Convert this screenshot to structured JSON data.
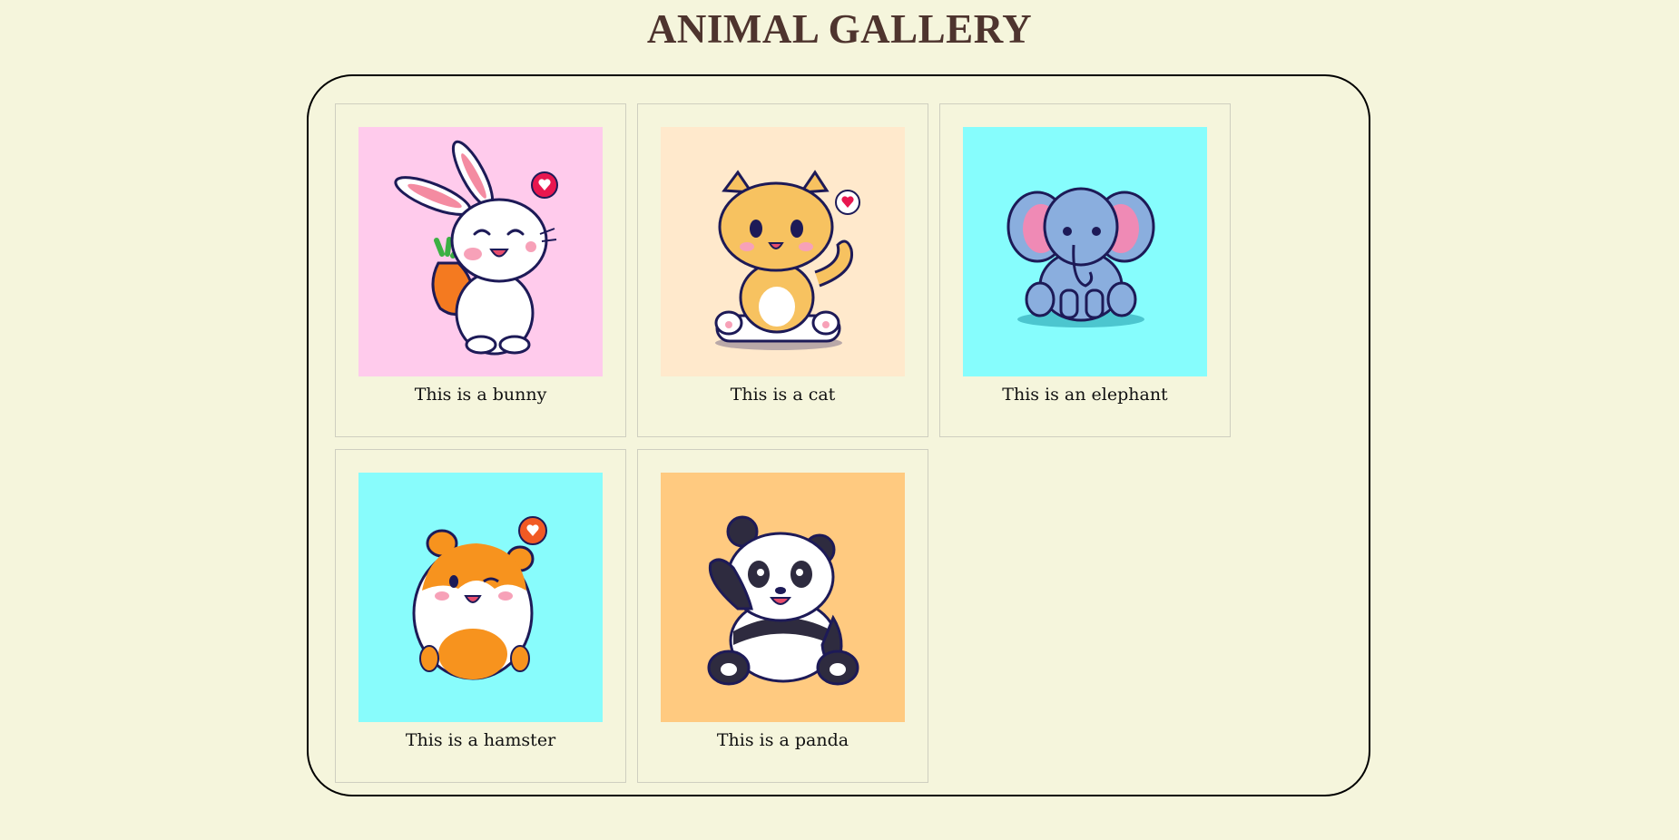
{
  "page": {
    "title": "ANIMAL GALLERY"
  },
  "gallery": {
    "items": [
      {
        "animal": "bunny",
        "caption": "This is a bunny",
        "background": "#ffcbec",
        "icon": "bunny-icon"
      },
      {
        "animal": "cat",
        "caption": "This is a cat",
        "background": "#ffe9cc",
        "icon": "cat-icon"
      },
      {
        "animal": "elephant",
        "caption": "This is an elephant",
        "background": "#86fdfd",
        "icon": "elephant-icon"
      },
      {
        "animal": "hamster",
        "caption": "This is a hamster",
        "background": "#88fcfc",
        "icon": "hamster-icon"
      },
      {
        "animal": "panda",
        "caption": "This is a panda",
        "background": "#ffca80",
        "icon": "panda-icon"
      }
    ]
  },
  "colors": {
    "page_background": "#f5f5dc",
    "title": "#4e342e",
    "gallery_border": "#000000",
    "card_border": "#cfcfc0"
  }
}
